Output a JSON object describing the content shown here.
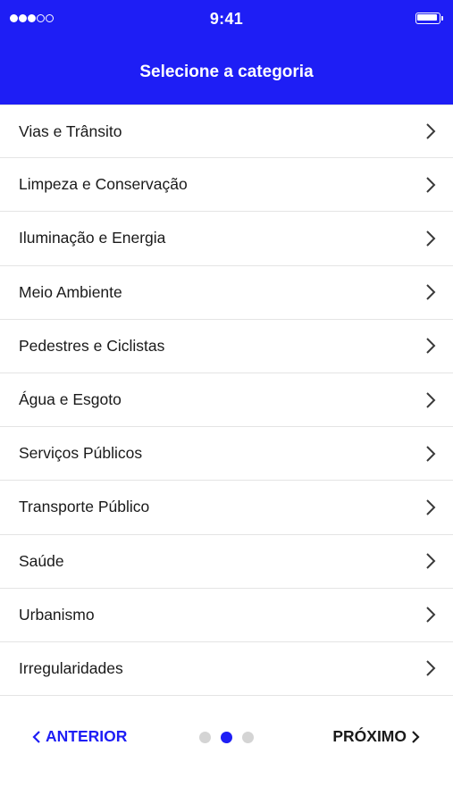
{
  "colors": {
    "brand": "#1e1ef5",
    "text": "#1a1a1a",
    "divider": "#e4e4e4",
    "dot_inactive": "#d4d4d4"
  },
  "status_bar": {
    "time": "9:41",
    "signal_icon": "signal-dots-icon",
    "battery_icon": "battery-icon"
  },
  "header": {
    "title": "Selecione a categoria"
  },
  "categories": [
    {
      "label": "Vias e Trânsito"
    },
    {
      "label": "Limpeza e Conservação"
    },
    {
      "label": "Iluminação e Energia"
    },
    {
      "label": "Meio Ambiente"
    },
    {
      "label": "Pedestres e Ciclistas"
    },
    {
      "label": "Água e Esgoto"
    },
    {
      "label": "Serviços Públicos"
    },
    {
      "label": "Transporte Público"
    },
    {
      "label": "Saúde"
    },
    {
      "label": "Urbanismo"
    },
    {
      "label": "Irregularidades"
    }
  ],
  "footer": {
    "prev_label": "ANTERIOR",
    "next_label": "PRÓXIMO",
    "page_count": 3,
    "current_page": 2
  }
}
